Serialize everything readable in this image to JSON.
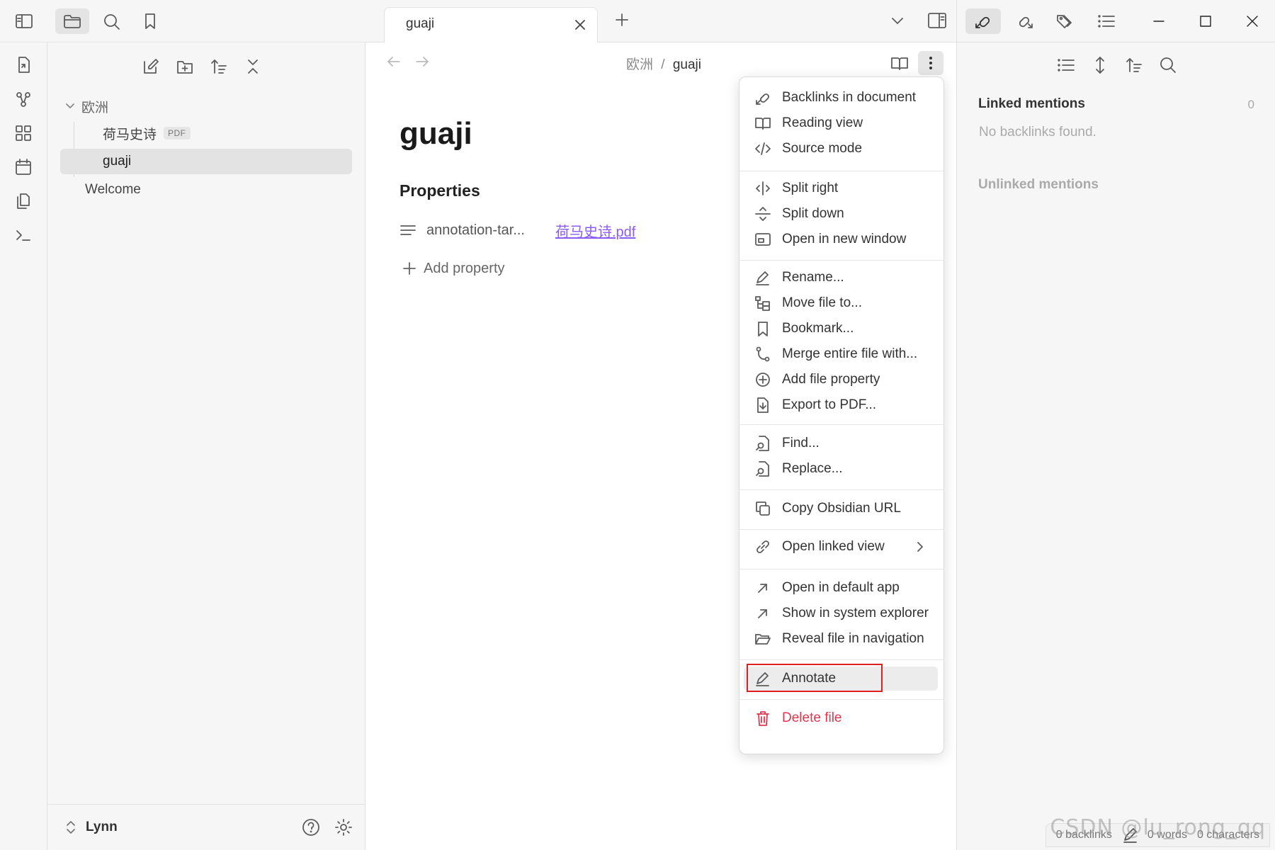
{
  "tab": {
    "title": "guaji"
  },
  "breadcrumb": {
    "folder": "欧洲",
    "sep": "/",
    "current": "guaji"
  },
  "explorer": {
    "folder": "欧洲",
    "files": [
      {
        "name": "荷马史诗",
        "badge": "PDF"
      },
      {
        "name": "guaji"
      }
    ],
    "root_file": "Welcome"
  },
  "vault": {
    "name": "Lynn"
  },
  "document": {
    "title": "guaji",
    "properties_heading": "Properties",
    "property_key": "annotation-tar...",
    "property_value": "荷马史诗.pdf",
    "add_property": "Add property"
  },
  "backlinks": {
    "linked_title": "Linked mentions",
    "linked_count": "0",
    "linked_empty": "No backlinks found.",
    "unlinked_title": "Unlinked mentions"
  },
  "status_bar": {
    "backlinks": "0 backlinks",
    "words": "0 words",
    "characters": "0 characters"
  },
  "watermark": "CSDN @lu_rong_qq",
  "menu": {
    "groups": [
      [
        {
          "label": "Backlinks in document",
          "icon": "backlinks-icon"
        },
        {
          "label": "Reading view",
          "icon": "book-open-icon"
        },
        {
          "label": "Source mode",
          "icon": "code-icon"
        }
      ],
      [
        {
          "label": "Split right",
          "icon": "split-right-icon"
        },
        {
          "label": "Split down",
          "icon": "split-down-icon"
        },
        {
          "label": "Open in new window",
          "icon": "new-window-icon"
        }
      ],
      [
        {
          "label": "Rename...",
          "icon": "pencil-icon"
        },
        {
          "label": "Move file to...",
          "icon": "folder-tree-icon"
        },
        {
          "label": "Bookmark...",
          "icon": "bookmark-icon"
        },
        {
          "label": "Merge entire file with...",
          "icon": "git-merge-icon"
        },
        {
          "label": "Add file property",
          "icon": "plus-circle-icon"
        },
        {
          "label": "Export to PDF...",
          "icon": "file-export-icon"
        }
      ],
      [
        {
          "label": "Find...",
          "icon": "file-search-icon"
        },
        {
          "label": "Replace...",
          "icon": "file-replace-icon"
        }
      ],
      [
        {
          "label": "Copy Obsidian URL",
          "icon": "copy-icon"
        }
      ],
      [
        {
          "label": "Open linked view",
          "icon": "link-icon"
        }
      ],
      [
        {
          "label": "Open in default app",
          "icon": "arrow-up-right-icon"
        },
        {
          "label": "Show in system explorer",
          "icon": "arrow-up-right-icon"
        },
        {
          "label": "Reveal file in navigation",
          "icon": "folder-open-icon"
        }
      ],
      [
        {
          "label": "Annotate",
          "icon": "pencil-icon"
        }
      ],
      [
        {
          "label": "Delete file",
          "icon": "trash-icon"
        }
      ]
    ]
  },
  "colors": {
    "accent": "#8a5cf5",
    "danger": "#e0374f",
    "highlight_box": "#e02020"
  }
}
